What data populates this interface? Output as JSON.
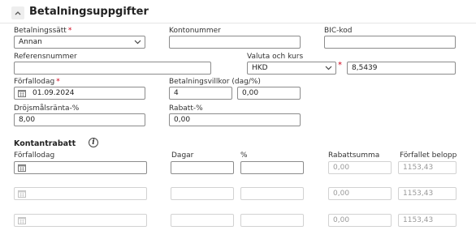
{
  "header": {
    "title": "Betalningsuppgifter"
  },
  "fields": {
    "payment_method": {
      "label": "Betalningssätt",
      "value": "Annan"
    },
    "account_number": {
      "label": "Kontonummer",
      "value": ""
    },
    "bic": {
      "label": "BIC-kod",
      "value": ""
    },
    "reference": {
      "label": "Referensnummer",
      "value": ""
    },
    "currency": {
      "label": "Valuta och kurs",
      "currency_value": "HKD",
      "rate_value": "8,5439"
    },
    "due_date": {
      "label": "Förfallodag",
      "value": "01.09.2024"
    },
    "payment_terms": {
      "label": "Betalningsvillkor (dag/%)",
      "days": "4",
      "percent": "0,00"
    },
    "penalty_interest": {
      "label": "Dröjsmålsränta-%",
      "value": "8,00"
    },
    "discount": {
      "label": "Rabatt-%",
      "value": "0,00"
    }
  },
  "cash_discount": {
    "title": "Kontantrabatt",
    "columns": {
      "due_date": "Förfallodag",
      "days": "Dagar",
      "percent": "%",
      "amount": "Rabattsumma",
      "due_amount": "Förfallet belopp"
    },
    "rows": [
      {
        "due_date": "",
        "days": "",
        "percent": "",
        "amount": "0,00",
        "due_amount": "1153,43"
      },
      {
        "due_date": "",
        "days": "",
        "percent": "",
        "amount": "0,00",
        "due_amount": "1153,43"
      },
      {
        "due_date": "",
        "days": "",
        "percent": "",
        "amount": "0,00",
        "due_amount": "1153,43"
      }
    ]
  },
  "icons": {
    "collapse": "chevron-up-icon",
    "select": "chevron-down-icon",
    "calendar": "calendar-icon",
    "info": "info-icon"
  },
  "colors": {
    "required": "#d0021b",
    "border": "#8c8c8c",
    "disabled_border": "#d2d2d2",
    "disabled_text": "#9a9a9a"
  }
}
